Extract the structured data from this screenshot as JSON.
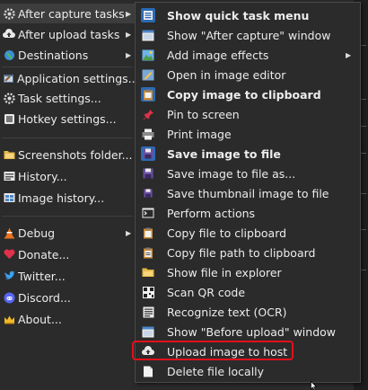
{
  "main_menu": {
    "items": [
      {
        "label": "After capture tasks",
        "icon": "gear-icon",
        "has_submenu": true,
        "highlighted": true
      },
      {
        "label": "After upload tasks",
        "icon": "cloud-icon",
        "has_submenu": true
      },
      {
        "label": "Destinations",
        "icon": "globe-icon",
        "has_submenu": true
      },
      {
        "label": "Application settings...",
        "icon": "wrench-icon"
      },
      {
        "label": "Task settings...",
        "icon": "gear-icon"
      },
      {
        "label": "Hotkey settings...",
        "icon": "keyboard-icon"
      },
      {
        "label": "Screenshots folder...",
        "icon": "folder-icon"
      },
      {
        "label": "History...",
        "icon": "history-icon"
      },
      {
        "label": "Image history...",
        "icon": "image-history-icon"
      },
      {
        "label": "Debug",
        "icon": "debug-cone-icon",
        "has_submenu": true
      },
      {
        "label": "Donate...",
        "icon": "heart-icon"
      },
      {
        "label": "Twitter...",
        "icon": "twitter-icon"
      },
      {
        "label": "Discord...",
        "icon": "discord-icon"
      },
      {
        "label": "About...",
        "icon": "crown-icon"
      }
    ]
  },
  "submenu": {
    "items": [
      {
        "label": "Show quick task menu",
        "bold": true,
        "checked": true
      },
      {
        "label": "Show \"After capture\" window"
      },
      {
        "label": "Add image effects",
        "has_submenu": true
      },
      {
        "label": "Open in image editor"
      },
      {
        "label": "Copy image to clipboard",
        "bold": true,
        "checked": true
      },
      {
        "label": "Pin to screen"
      },
      {
        "label": "Print image"
      },
      {
        "label": "Save image to file",
        "bold": true,
        "checked": true
      },
      {
        "label": "Save image to file as..."
      },
      {
        "label": "Save thumbnail image to file"
      },
      {
        "label": "Perform actions"
      },
      {
        "label": "Copy file to clipboard"
      },
      {
        "label": "Copy file path to clipboard"
      },
      {
        "label": "Show file in explorer"
      },
      {
        "label": "Scan QR code"
      },
      {
        "label": "Recognize text (OCR)"
      },
      {
        "label": "Show \"Before upload\" window"
      },
      {
        "label": "Upload image to host",
        "annotated": true
      },
      {
        "label": "Delete file locally"
      }
    ]
  },
  "colors": {
    "menu_bg": "#2b2b2b",
    "text": "#ececec",
    "check_bg": "#2d6ab3",
    "annotation": "#e3101b"
  }
}
